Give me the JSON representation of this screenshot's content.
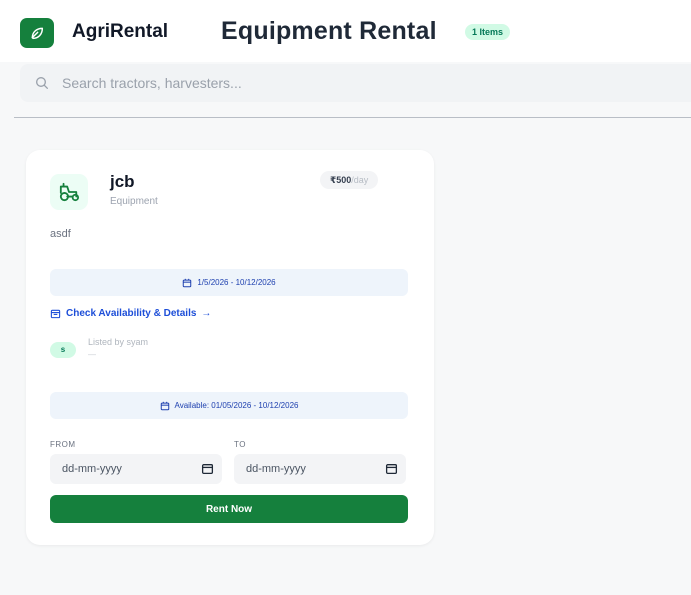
{
  "header": {
    "brand": "AgriRental",
    "title": "Equipment Rental",
    "count_badge": "1 Items",
    "logo_icon": "leaf-icon"
  },
  "search": {
    "placeholder": "Search tractors, harvesters...",
    "value": ""
  },
  "listing": {
    "name": "jcb",
    "category": "Equipment",
    "price": "₹500",
    "price_unit": "/day",
    "description": "asdf",
    "date_range": "1/5/2026 - 10/12/2026",
    "check_link": "Check Availability & Details",
    "check_arrow": "→",
    "owner_initial": "s",
    "owner_text": "Listed by syam",
    "owner_sub": "—",
    "availability": "Available: 01/05/2026 - 10/12/2026",
    "from_label": "FROM",
    "to_label": "TO",
    "from_value": "dd-mm-yyyy",
    "to_value": "dd-mm-yyyy",
    "rent_label": "Rent Now",
    "icon": "tractor-icon"
  },
  "colors": {
    "brand_green": "#15803d",
    "link_blue": "#1d4ed8",
    "banner_bg": "#eef4fb"
  }
}
